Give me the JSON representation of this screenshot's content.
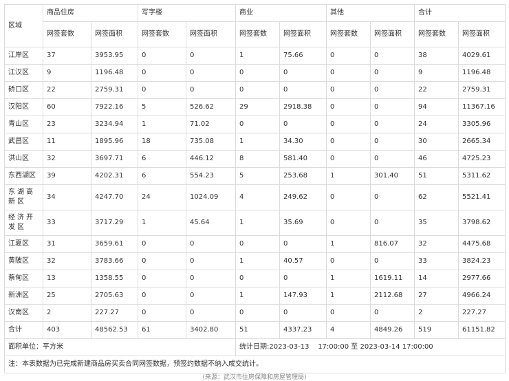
{
  "header": {
    "region": "区域",
    "groups": [
      "商品住房",
      "写字楼",
      "商业",
      "其他",
      "合计"
    ],
    "count": "网签套数",
    "area": "网签面积"
  },
  "rows": [
    {
      "region": "江岸区",
      "values": [
        "37",
        "3953.95",
        "0",
        "0",
        "1",
        "75.66",
        "0",
        "0",
        "38",
        "4029.61"
      ]
    },
    {
      "region": "江汉区",
      "values": [
        "9",
        "1196.48",
        "0",
        "0",
        "0",
        "0",
        "0",
        "0",
        "9",
        "1196.48"
      ]
    },
    {
      "region": "硚口区",
      "values": [
        "22",
        "2759.31",
        "0",
        "0",
        "0",
        "0",
        "0",
        "0",
        "22",
        "2759.31"
      ]
    },
    {
      "region": "汉阳区",
      "values": [
        "60",
        "7922.16",
        "5",
        "526.62",
        "29",
        "2918.38",
        "0",
        "0",
        "94",
        "11367.16"
      ]
    },
    {
      "region": "青山区",
      "values": [
        "23",
        "3234.94",
        "1",
        "71.02",
        "0",
        "0",
        "0",
        "0",
        "24",
        "3305.96"
      ]
    },
    {
      "region": "武昌区",
      "values": [
        "11",
        "1895.96",
        "18",
        "735.08",
        "1",
        "34.30",
        "0",
        "0",
        "30",
        "2665.34"
      ]
    },
    {
      "region": "洪山区",
      "values": [
        "32",
        "3697.71",
        "6",
        "446.12",
        "8",
        "581.40",
        "0",
        "0",
        "46",
        "4725.23"
      ]
    },
    {
      "region": "东西湖区",
      "values": [
        "39",
        "4202.31",
        "6",
        "554.23",
        "5",
        "253.68",
        "1",
        "301.40",
        "51",
        "5311.62"
      ]
    },
    {
      "region": "东湖高新区",
      "values": [
        "34",
        "4247.70",
        "24",
        "1024.09",
        "4",
        "249.62",
        "0",
        "0",
        "62",
        "5521.41"
      ]
    },
    {
      "region": "经济开发区",
      "values": [
        "33",
        "3717.29",
        "1",
        "45.64",
        "1",
        "35.69",
        "0",
        "0",
        "35",
        "3798.62"
      ]
    },
    {
      "region": "江夏区",
      "values": [
        "31",
        "3659.61",
        "0",
        "0",
        "0",
        "0",
        "1",
        "816.07",
        "32",
        "4475.68"
      ]
    },
    {
      "region": "黄陂区",
      "values": [
        "32",
        "3783.66",
        "0",
        "0",
        "1",
        "40.57",
        "0",
        "0",
        "33",
        "3824.23"
      ]
    },
    {
      "region": "蔡甸区",
      "values": [
        "13",
        "1358.55",
        "0",
        "0",
        "0",
        "0",
        "1",
        "1619.11",
        "14",
        "2977.66"
      ]
    },
    {
      "region": "新洲区",
      "values": [
        "25",
        "2705.63",
        "0",
        "0",
        "1",
        "147.93",
        "1",
        "2112.68",
        "27",
        "4966.24"
      ]
    },
    {
      "region": "汉南区",
      "values": [
        "2",
        "227.27",
        "0",
        "0",
        "0",
        "0",
        "0",
        "0",
        "2",
        "227.27"
      ]
    },
    {
      "region": "合计",
      "values": [
        "403",
        "48562.53",
        "61",
        "3402.80",
        "51",
        "4337.23",
        "4",
        "4849.26",
        "519",
        "61151.82"
      ]
    }
  ],
  "footer": {
    "unit": "面积单位：平方米",
    "period": "统计日期:2023-03-13    17:00:00 至 2023-03-14 17:00:00"
  },
  "note": "注：本表数据为已完成新建商品房买卖合同网签数据，预签约数据不纳入成交统计。",
  "caption": "(来源：武汉市住房保障和房屋管理局)"
}
